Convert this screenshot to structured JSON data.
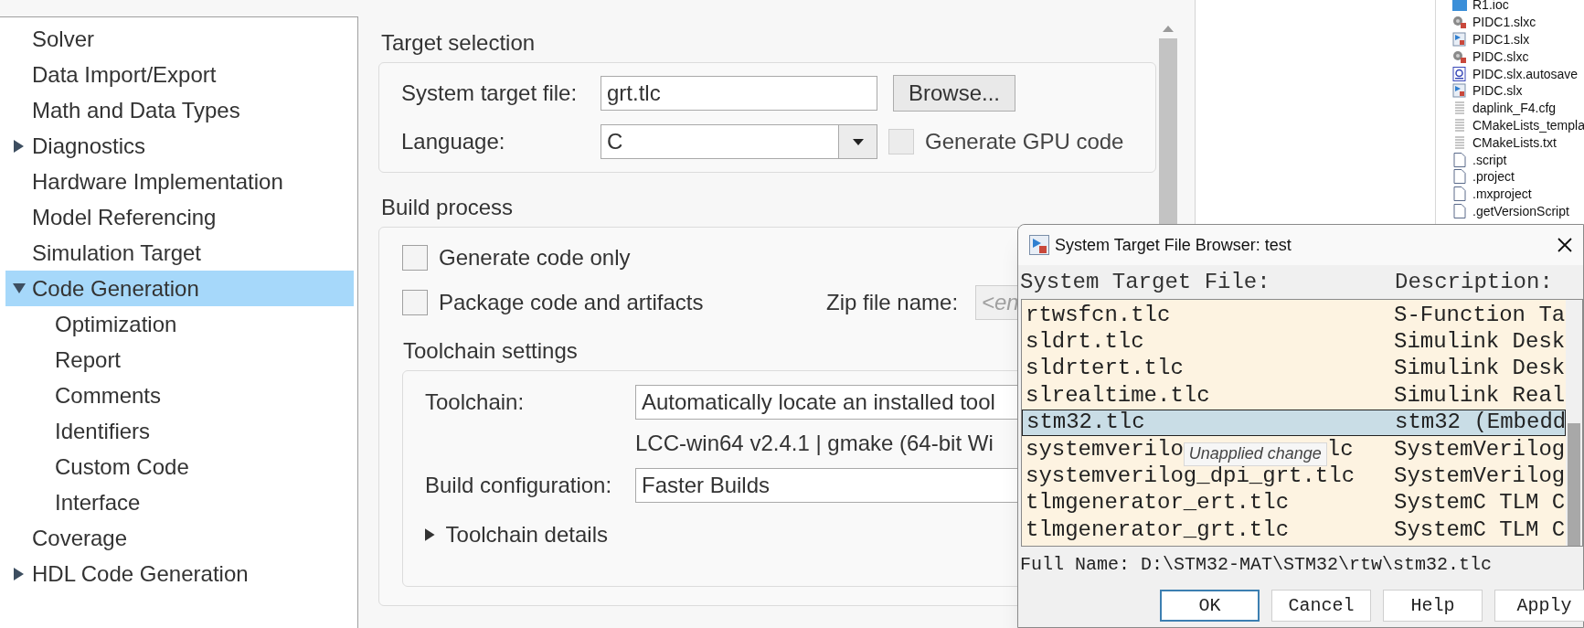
{
  "sidebar": {
    "items": [
      {
        "label": "Solver",
        "selected": false
      },
      {
        "label": "Data Import/Export",
        "selected": false
      },
      {
        "label": "Math and Data Types",
        "selected": false
      },
      {
        "label": "Diagnostics",
        "selected": false,
        "expanded": false
      },
      {
        "label": "Hardware Implementation",
        "selected": false
      },
      {
        "label": "Model Referencing",
        "selected": false
      },
      {
        "label": "Simulation Target",
        "selected": false
      },
      {
        "label": "Code Generation",
        "selected": true,
        "expanded": true,
        "children": [
          {
            "label": "Optimization",
            "selected": false
          },
          {
            "label": "Report",
            "selected": false
          },
          {
            "label": "Comments",
            "selected": false
          },
          {
            "label": "Identifiers",
            "selected": false
          },
          {
            "label": "Custom Code",
            "selected": false
          },
          {
            "label": "Interface",
            "selected": false
          }
        ]
      },
      {
        "label": "Coverage",
        "selected": false
      },
      {
        "label": "HDL Code Generation",
        "selected": false,
        "expanded": false
      }
    ]
  },
  "target_selection": {
    "title": "Target selection",
    "system_target_file": {
      "label": "System target file:",
      "value": "grt.tlc"
    },
    "browse_button": "Browse...",
    "language": {
      "label": "Language:",
      "value": "C"
    },
    "generate_gpu_code": {
      "label": "Generate GPU code",
      "checked": false,
      "disabled": true
    }
  },
  "build_process": {
    "title": "Build process",
    "generate_code_only": {
      "label": "Generate code only",
      "checked": false
    },
    "package_code": {
      "label": "Package code and artifacts",
      "checked": false
    },
    "zip_file_name": {
      "label": "Zip file name:",
      "placeholder": "<en"
    },
    "toolchain_settings": {
      "title": "Toolchain settings",
      "toolchain": {
        "label": "Toolchain:",
        "value": "Automatically locate an installed tool"
      },
      "toolchain_info": "LCC-win64 v2.4.1 | gmake (64-bit Wi",
      "build_configuration": {
        "label": "Build configuration:",
        "value": "Faster Builds"
      },
      "toolchain_details": {
        "label": "Toolchain details",
        "expanded": false
      }
    }
  },
  "file_list": [
    {
      "name": "R1.ioc",
      "kind": "mx"
    },
    {
      "name": "PIDC1.slxc",
      "kind": "cache"
    },
    {
      "name": "PIDC1.slx",
      "kind": "model"
    },
    {
      "name": "PIDC.slxc",
      "kind": "cache"
    },
    {
      "name": "PIDC.slx.autosave",
      "kind": "autosave"
    },
    {
      "name": "PIDC.slx",
      "kind": "model"
    },
    {
      "name": "daplink_F4.cfg",
      "kind": "text"
    },
    {
      "name": "CMakeLists_templa",
      "kind": "text"
    },
    {
      "name": "CMakeLists.txt",
      "kind": "text"
    },
    {
      "name": ".script",
      "kind": "file"
    },
    {
      "name": ".project",
      "kind": "file"
    },
    {
      "name": ".mxproject",
      "kind": "file"
    },
    {
      "name": ".getVersionScript",
      "kind": "file"
    }
  ],
  "dialog": {
    "title": "System Target File Browser: test",
    "columns": [
      "System Target File:",
      "Description:"
    ],
    "rows": [
      {
        "file": "rtwsfcn.tlc",
        "description": "S-Function Ta",
        "selected": false
      },
      {
        "file": "sldrt.tlc",
        "description": "Simulink Desk",
        "selected": false
      },
      {
        "file": "sldrtert.tlc",
        "description": "Simulink Desk",
        "selected": false
      },
      {
        "file": "slrealtime.tlc",
        "description": "Simulink Real",
        "selected": false
      },
      {
        "file": "stm32.tlc",
        "description": "stm32 (Embedd",
        "selected": true
      },
      {
        "file": "systemverilo",
        "file_end": "lc",
        "tooltip": "Unapplied change",
        "description": "SystemVerilog",
        "selected": false
      },
      {
        "file": "systemverilog_dpi_grt.tlc",
        "description": "SystemVerilog",
        "selected": false
      },
      {
        "file": "tlmgenerator_ert.tlc",
        "description": "SystemC TLM C",
        "selected": false
      },
      {
        "file": "tlmgenerator_grt.tlc",
        "description": "SystemC TLM C",
        "selected": false
      }
    ],
    "full_name": "Full Name: D:\\STM32-MAT\\STM32\\rtw\\stm32.tlc",
    "buttons": [
      {
        "label": "OK",
        "default": true
      },
      {
        "label": "Cancel",
        "default": false
      },
      {
        "label": "Help",
        "default": false
      },
      {
        "label": "Apply",
        "default": false
      }
    ]
  }
}
